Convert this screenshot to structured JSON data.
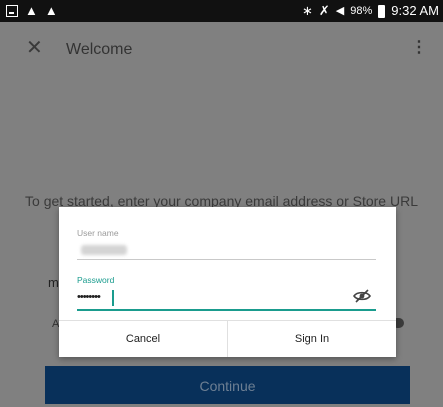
{
  "status_bar": {
    "icons": [
      "screenshot-icon",
      "notification-icon",
      "notification-icon",
      "bluetooth-icon",
      "mute-icon",
      "wifi-icon",
      "battery-icon"
    ],
    "battery": "98%",
    "time": "9:32 AM"
  },
  "app_bar": {
    "close_glyph": "✕",
    "title": "Welcome",
    "overflow_glyph": "⋮"
  },
  "screen": {
    "intro_text": "To get started, enter your company email address or Store URL",
    "email_fragment": "m",
    "a_fragment": "A",
    "continue_label": "Continue"
  },
  "dialog": {
    "username_label": "User name",
    "username_value_obscured": true,
    "password_label": "Password",
    "password_value": "••••••••",
    "cancel_label": "Cancel",
    "signin_label": "Sign In"
  },
  "colors": {
    "accent": "#1a9c8e",
    "continue_button": "#08305a",
    "overlay": "#808080"
  }
}
